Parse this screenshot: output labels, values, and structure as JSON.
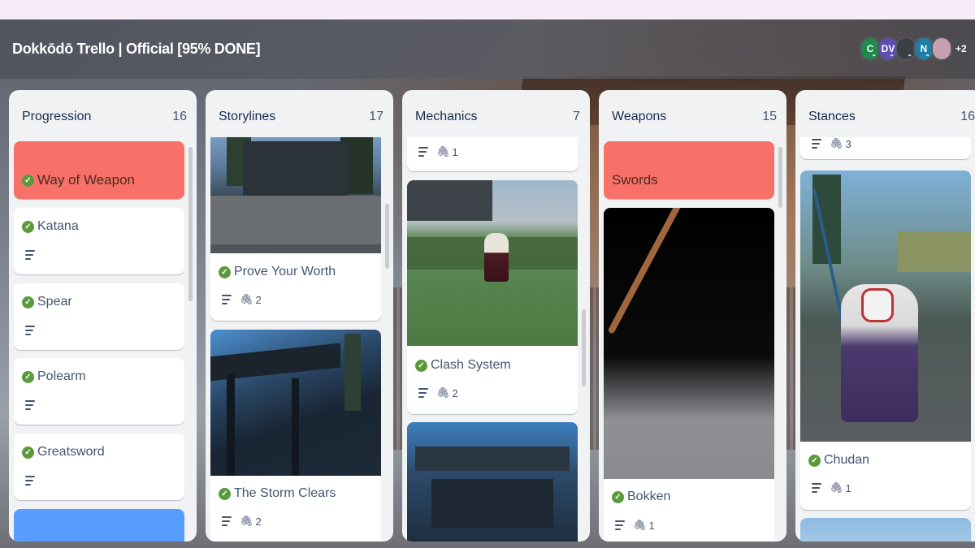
{
  "board": {
    "title": "Dokkōdō Trello | Official [95% DONE]",
    "members": [
      {
        "initials": "C",
        "color": "#1f8a4c"
      },
      {
        "initials": "DV",
        "color": "#5e4db2"
      },
      {
        "initials": "",
        "color": "#3a3f44"
      },
      {
        "initials": "N",
        "color": "#1d7fa6"
      },
      {
        "initials": "",
        "color": "#c7a1b0"
      }
    ],
    "more_members": "+2"
  },
  "lists": [
    {
      "title": "Progression",
      "count": "16",
      "cards": [
        {
          "title": "Way of Weapon",
          "type": "label-red",
          "checked": true
        },
        {
          "title": "Katana",
          "checked": true,
          "has_description": true
        },
        {
          "title": "Spear",
          "checked": true,
          "has_description": true
        },
        {
          "title": "Polearm",
          "checked": true,
          "has_description": true
        },
        {
          "title": "Greatsword",
          "checked": true,
          "has_description": true
        },
        {
          "title": "",
          "type": "label-blue"
        }
      ]
    },
    {
      "title": "Storylines",
      "count": "17",
      "cards": [
        {
          "title": "Prove Your Worth",
          "checked": true,
          "has_description": true,
          "attachments": "2",
          "cover": "dojo-courtyard"
        },
        {
          "title": "The Storm Clears",
          "checked": true,
          "has_description": true,
          "attachments": "2",
          "cover": "night-building"
        }
      ]
    },
    {
      "title": "Mechanics",
      "count": "7",
      "cards": [
        {
          "title": "",
          "has_description": true,
          "attachments": "1"
        },
        {
          "title": "Clash System",
          "checked": true,
          "has_description": true,
          "attachments": "2",
          "cover": "grass-field"
        },
        {
          "title": "",
          "cover": "gate-roof"
        }
      ]
    },
    {
      "title": "Weapons",
      "count": "15",
      "cards": [
        {
          "title": "Swords",
          "type": "label-red"
        },
        {
          "title": "Bokken",
          "checked": true,
          "has_description": true,
          "attachments": "1",
          "cover": "wooden-sword"
        }
      ]
    },
    {
      "title": "Stances",
      "count": "16",
      "cards": [
        {
          "title": "",
          "has_description": true,
          "attachments": "3"
        },
        {
          "title": "Chudan",
          "checked": true,
          "has_description": true,
          "attachments": "1",
          "cover": "masked-warrior"
        },
        {
          "title": "",
          "cover": "sky"
        }
      ]
    }
  ],
  "colors": {
    "label_red": "#f87168",
    "label_blue": "#579dff",
    "check_green": "#5b9a3c",
    "list_bg": "#f1f2f4"
  },
  "icons": {
    "check": "check-circle-icon",
    "description": "description-icon",
    "attachment": "paperclip-icon"
  }
}
